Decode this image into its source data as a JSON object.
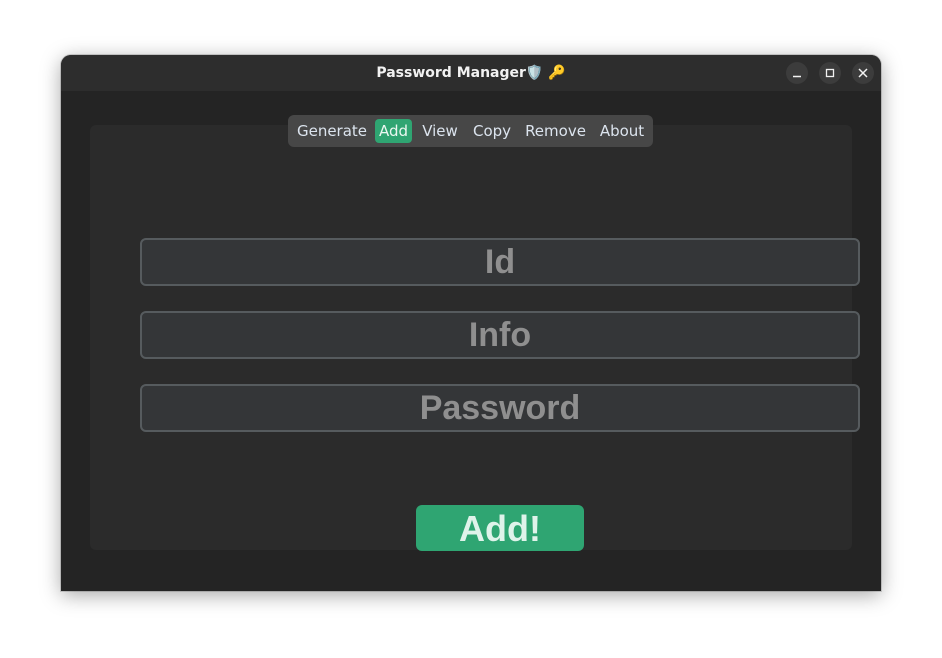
{
  "window": {
    "title": "Password Manager🛡️ 🔑",
    "controls": [
      "minimize-icon",
      "maximize-icon",
      "close-icon"
    ]
  },
  "tabs": {
    "items": [
      {
        "label": "Generate",
        "active": false
      },
      {
        "label": "Add",
        "active": true
      },
      {
        "label": "View",
        "active": false
      },
      {
        "label": "Copy",
        "active": false
      },
      {
        "label": "Remove",
        "active": false
      },
      {
        "label": "About",
        "active": false
      }
    ]
  },
  "form": {
    "id_placeholder": "Id",
    "info_placeholder": "Info",
    "password_placeholder": "Password",
    "submit_label": "Add!"
  },
  "colors": {
    "accent": "#2fa572",
    "background": "#242424",
    "panel": "#2b2b2b",
    "field": "#343638"
  }
}
